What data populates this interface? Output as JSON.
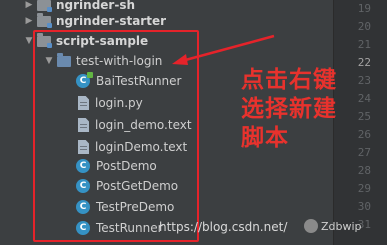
{
  "tree": {
    "rows": [
      {
        "label": "ngrinder-sh",
        "kind": "folder",
        "expanded": false
      },
      {
        "label": "ngrinder-starter",
        "kind": "folder",
        "expanded": false
      },
      {
        "label": "script-sample",
        "kind": "folder",
        "expanded": true
      },
      {
        "label": "test-with-login",
        "kind": "src-folder",
        "expanded": true
      },
      {
        "label": "BaiTestRunner",
        "kind": "class",
        "icon": "class-runner-icon"
      },
      {
        "label": "login.py",
        "kind": "file"
      },
      {
        "label": "login_demo.text",
        "kind": "file"
      },
      {
        "label": "loginDemo.text",
        "kind": "file"
      },
      {
        "label": "PostDemo",
        "kind": "class"
      },
      {
        "label": "PostGetDemo",
        "kind": "class"
      },
      {
        "label": "TestPreDemo",
        "kind": "class"
      },
      {
        "label": "TestRunner",
        "kind": "class"
      }
    ]
  },
  "gutter": {
    "line_numbers": [
      "19",
      "20",
      "21",
      "22",
      "23",
      "24",
      "25",
      "26",
      "27",
      "28",
      "29",
      "30",
      "31"
    ],
    "current_line": "22"
  },
  "annotation": {
    "text": "点击右键\n选择新建\n脚本",
    "color": "#e8322d"
  },
  "watermark": {
    "url": "https://blog.csdn.net/",
    "brand": "Zdbwip"
  },
  "colors": {
    "highlight_border": "#e5232a",
    "class_icon": "#3592c4"
  }
}
